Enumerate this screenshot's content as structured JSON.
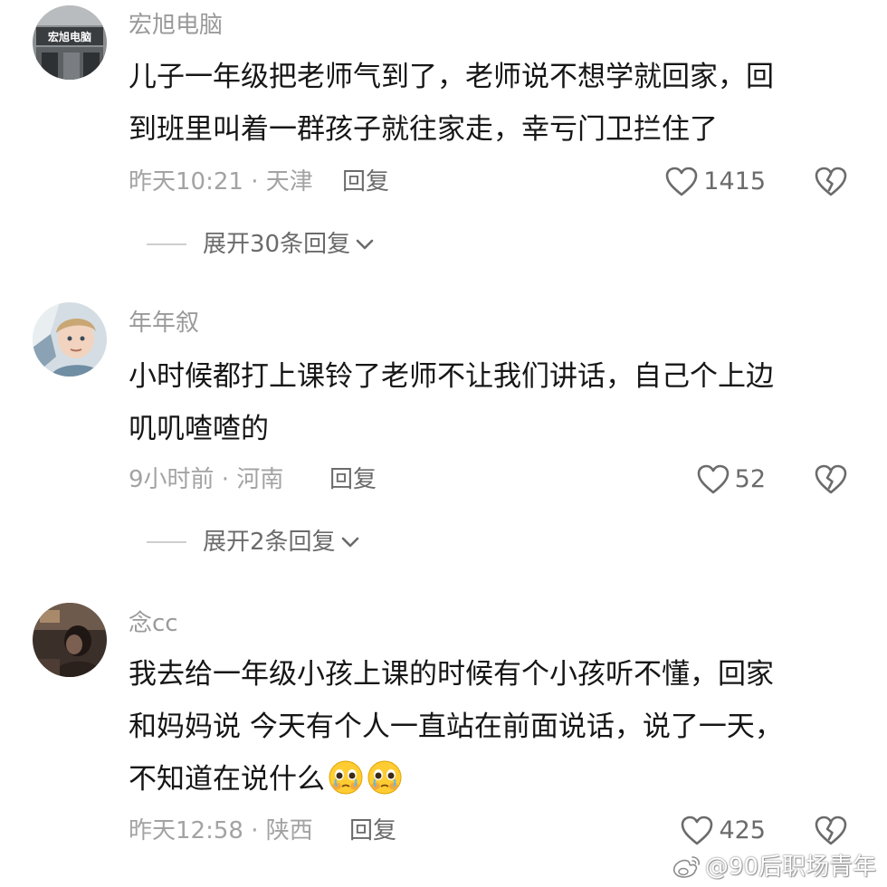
{
  "comments": [
    {
      "username": "宏旭电脑",
      "avatar_icon": "storefront-avatar",
      "avatar_sign_text": "宏旭电脑",
      "lines": [
        "儿子一年级把老师气到了，老师说不想学就回家，回",
        "到班里叫着一群孩子就往家走，幸亏门卫拦住了"
      ],
      "meta": "昨天10:21 · 天津",
      "reply_label": "回复",
      "likes": "1415",
      "expand_label": "展开30条回复"
    },
    {
      "username": "年年叙",
      "avatar_icon": "child-portrait-avatar",
      "lines": [
        "小时候都打上课铃了老师不让我们讲话，自己个上边",
        "叽叽喳喳的"
      ],
      "meta": "9小时前 · 河南",
      "reply_label": "回复",
      "likes": "52",
      "expand_label": "展开2条回复"
    },
    {
      "username": "念cc",
      "avatar_icon": "dim-room-portrait-avatar",
      "lines": [
        "我去给一年级小孩上课的时候有个小孩听不懂，回家",
        "和妈妈说 今天有个人一直站在前面说话，说了一天，",
        "不知道在说什么"
      ],
      "emoji_icons": [
        "pleading-face-emoji",
        "pleading-face-emoji"
      ],
      "meta": "昨天12:58 · 陕西",
      "reply_label": "回复",
      "likes": "425"
    }
  ],
  "icons": {
    "like": "heart-outline-icon",
    "dislike": "broken-heart-icon",
    "expand": "chevron-down-icon",
    "watermark": "weibo-logo-icon"
  },
  "watermark": "@90后职场青年",
  "colors": {
    "text_primary": "#161616",
    "text_secondary": "#9a9a9a",
    "text_action": "#6b6b6b",
    "background": "#ffffff"
  }
}
